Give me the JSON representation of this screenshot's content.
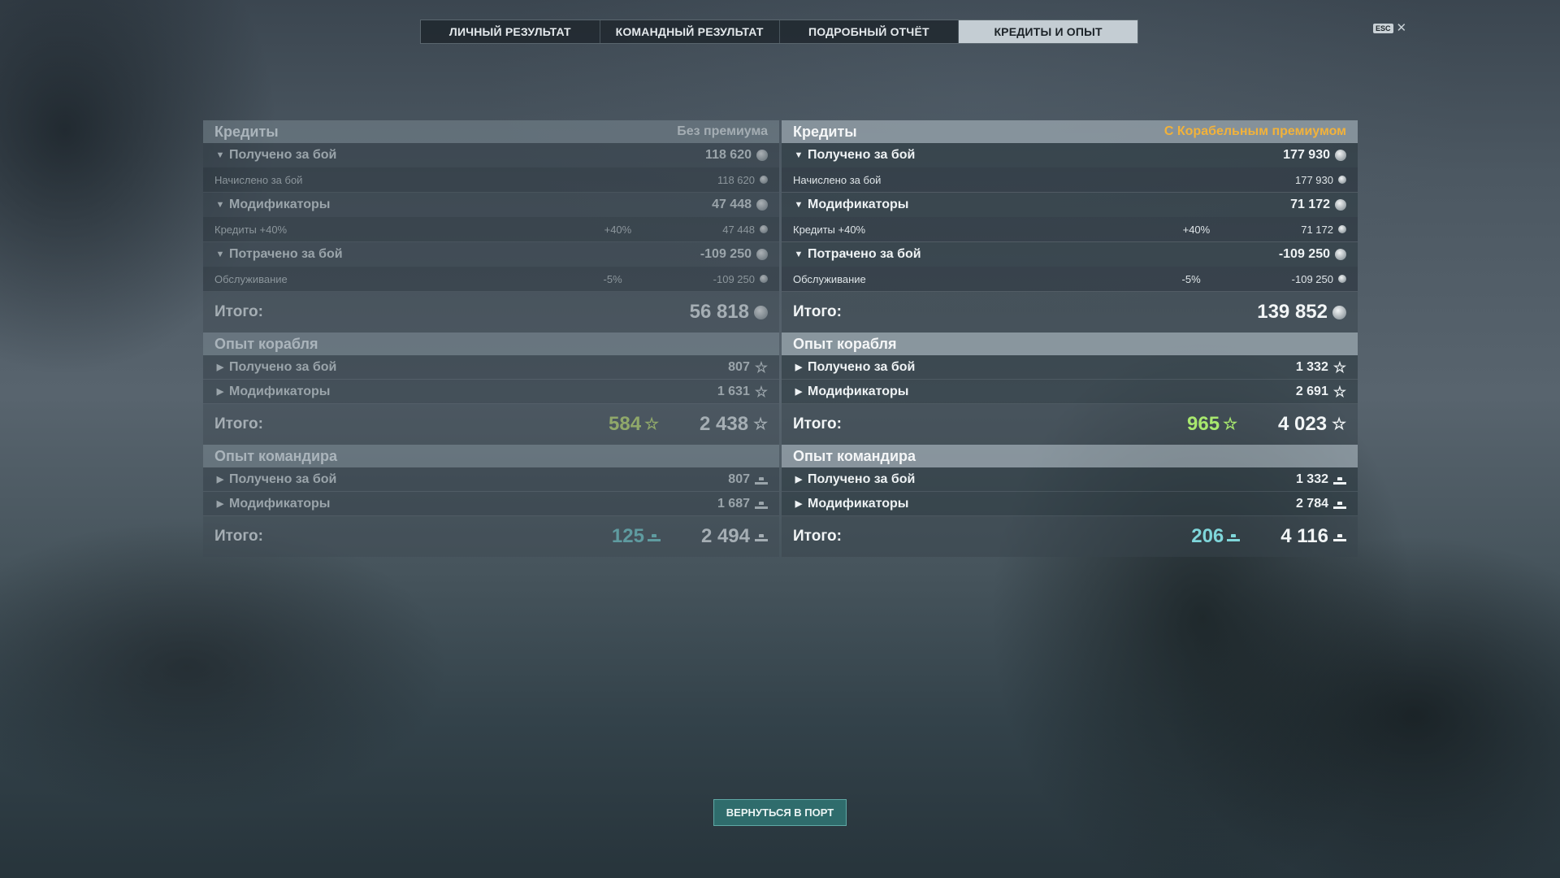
{
  "tabs": [
    "ЛИЧНЫЙ РЕЗУЛЬТАТ",
    "КОМАНДНЫЙ РЕЗУЛЬТАТ",
    "ПОДРОБНЫЙ ОТЧЁТ",
    "КРЕДИТЫ И ОПЫТ"
  ],
  "active_tab": "КРЕДИТЫ И ОПЫТ",
  "esc_label": "ESC",
  "close_symbol": "✕",
  "left": {
    "credits_title": "Кредиты",
    "credits_subtitle": "Без премиума",
    "earned_label": "Получено за бой",
    "earned_value": "118 620",
    "earned_detail_label": "Начислено за бой",
    "earned_detail_value": "118 620",
    "modifiers_label": "Модификаторы",
    "modifiers_value": "47 448",
    "modifiers_detail_label": "Кредиты +40%",
    "modifiers_detail_pct": "+40%",
    "modifiers_detail_value": "47 448",
    "spent_label": "Потрачено за бой",
    "spent_value": "-109 250",
    "spent_detail_label": "Обслуживание",
    "spent_detail_pct": "-5%",
    "spent_detail_value": "-109 250",
    "credits_total_label": "Итого:",
    "credits_total": "56 818",
    "ship_xp_title": "Опыт корабля",
    "ship_earned_label": "Получено за бой",
    "ship_earned_value": "807",
    "ship_mod_label": "Модификаторы",
    "ship_mod_value": "1 631",
    "ship_total_label": "Итого:",
    "ship_free_xp": "584",
    "ship_total": "2 438",
    "cmd_xp_title": "Опыт командира",
    "cmd_earned_label": "Получено за бой",
    "cmd_earned_value": "807",
    "cmd_mod_label": "Модификаторы",
    "cmd_mod_value": "1 687",
    "cmd_total_label": "Итого:",
    "cmd_elite_xp": "125",
    "cmd_total": "2 494"
  },
  "right": {
    "credits_title": "Кредиты",
    "credits_subtitle": "С Корабельным премиумом",
    "earned_label": "Получено за бой",
    "earned_value": "177 930",
    "earned_detail_label": "Начислено за бой",
    "earned_detail_value": "177 930",
    "modifiers_label": "Модификаторы",
    "modifiers_value": "71 172",
    "modifiers_detail_label": "Кредиты +40%",
    "modifiers_detail_pct": "+40%",
    "modifiers_detail_value": "71 172",
    "spent_label": "Потрачено за бой",
    "spent_value": "-109 250",
    "spent_detail_label": "Обслуживание",
    "spent_detail_pct": "-5%",
    "spent_detail_value": "-109 250",
    "credits_total_label": "Итого:",
    "credits_total": "139 852",
    "ship_xp_title": "Опыт корабля",
    "ship_earned_label": "Получено за бой",
    "ship_earned_value": "1 332",
    "ship_mod_label": "Модификаторы",
    "ship_mod_value": "2 691",
    "ship_total_label": "Итого:",
    "ship_free_xp": "965",
    "ship_total": "4 023",
    "cmd_xp_title": "Опыт командира",
    "cmd_earned_label": "Получено за бой",
    "cmd_earned_value": "1 332",
    "cmd_mod_label": "Модификаторы",
    "cmd_mod_value": "2 784",
    "cmd_total_label": "Итого:",
    "cmd_elite_xp": "206",
    "cmd_total": "4 116"
  },
  "return_button": "ВЕРНУТЬСЯ В ПОРТ",
  "icons": {
    "credits": "credits-coin-icon",
    "xp": "star-icon",
    "commander_xp": "commander-xp-icon",
    "expanded": "triangle-down-icon",
    "collapsed": "triangle-right-icon"
  },
  "colors": {
    "premium_label": "#f2b23a",
    "free_xp": "#a8e86e",
    "elite_cmd_xp": "#7fd6da",
    "port_button": "#2f6c6c",
    "active_tab": "#c4cdd3"
  }
}
